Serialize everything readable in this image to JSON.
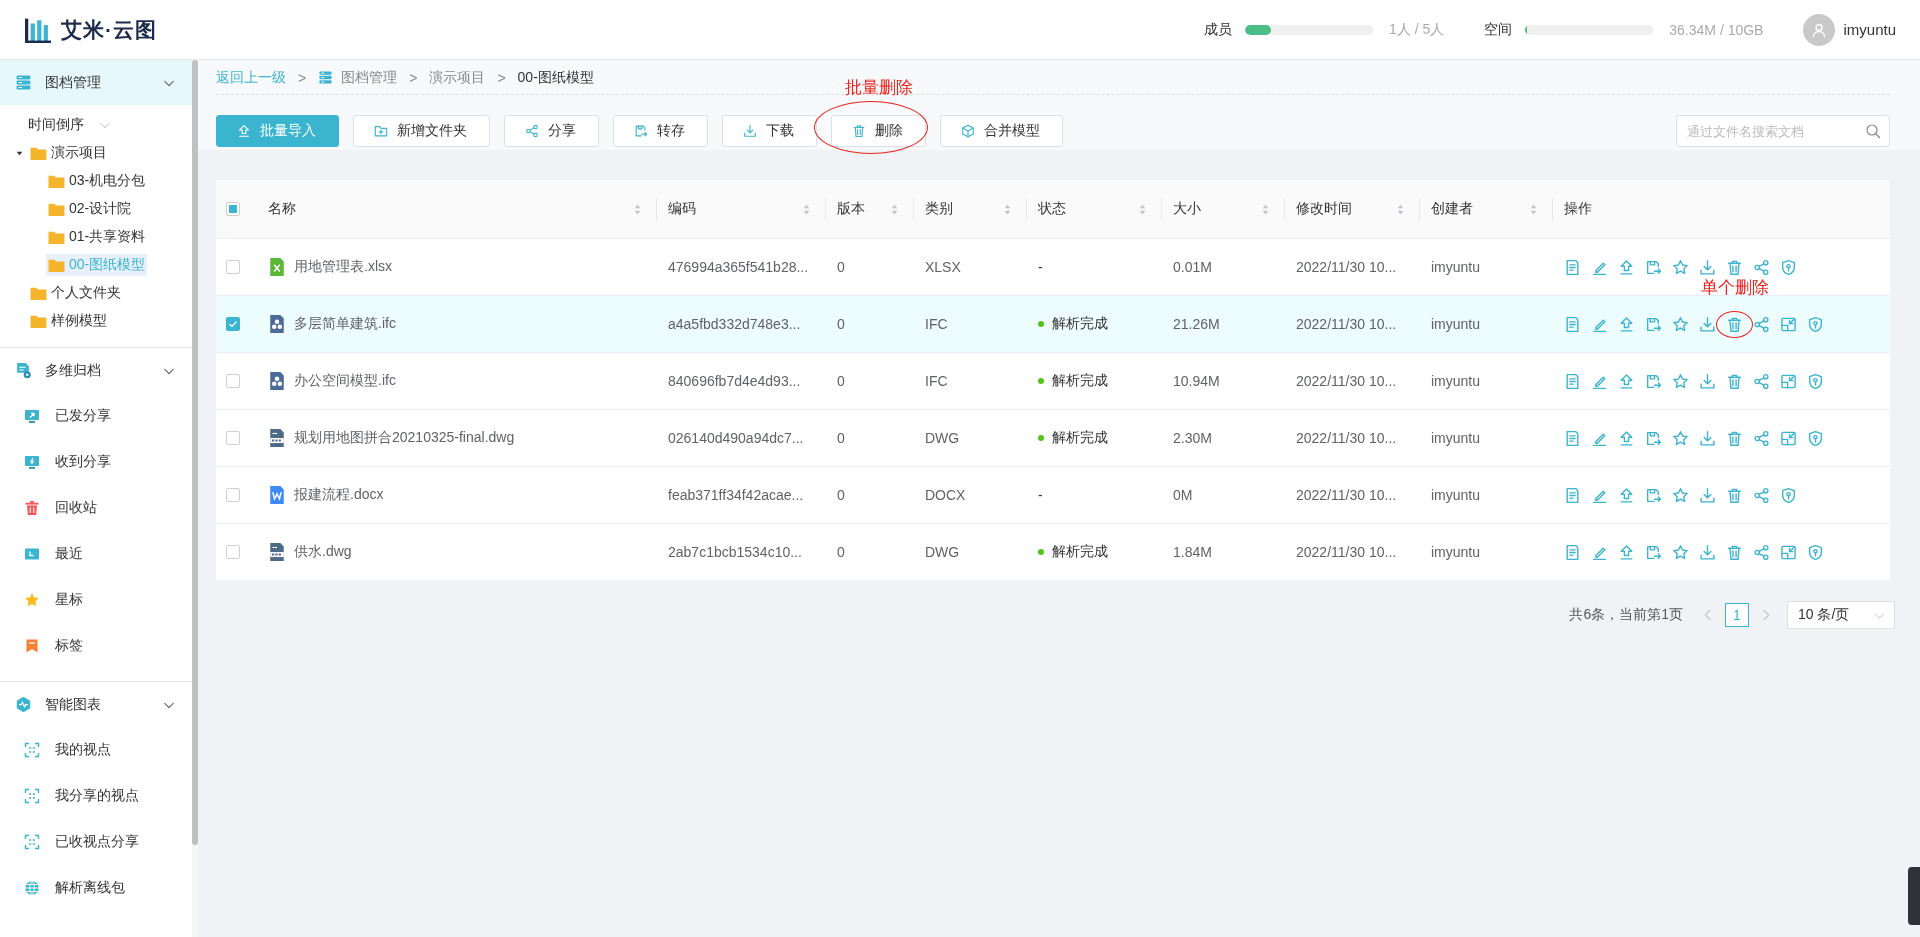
{
  "header": {
    "logo": "艾米·云图",
    "meters": [
      {
        "label": "成员",
        "level": 0.2,
        "reading": "1人 / 5人"
      },
      {
        "label": "空间",
        "level": 0.004,
        "reading": "36.34M / 10GB"
      }
    ],
    "user": "imyuntu"
  },
  "sidebar": {
    "sections": [
      {
        "title": "图档管理",
        "kind": "files",
        "active": true,
        "expanded": true,
        "sort": "时间倒序",
        "tree": [
          {
            "label": "演示项目",
            "selected": false,
            "expanded": true,
            "children": [
              {
                "label": "03-机电分包",
                "selected": false
              },
              {
                "label": "02-设计院",
                "selected": false
              },
              {
                "label": "01-共享资料",
                "selected": false
              },
              {
                "label": "00-图纸模型",
                "selected": true
              }
            ]
          },
          {
            "label": "个人文件夹",
            "selected": false
          },
          {
            "label": "样例模型",
            "selected": false
          }
        ]
      },
      {
        "title": "多维归档",
        "kind": "archive",
        "active": false,
        "expanded": true,
        "items": [
          {
            "label": "已发分享",
            "kind": "sent"
          },
          {
            "label": "收到分享",
            "kind": "received"
          },
          {
            "label": "回收站",
            "kind": "trash"
          },
          {
            "label": "最近",
            "kind": "recent"
          },
          {
            "label": "星标",
            "kind": "star"
          },
          {
            "label": "标签",
            "kind": "tag"
          }
        ]
      },
      {
        "title": "智能图表",
        "kind": "chart",
        "active": false,
        "expanded": true,
        "items": [
          {
            "label": "我的视点",
            "kind": "viewpoint"
          },
          {
            "label": "我分享的视点",
            "kind": "viewpoint"
          },
          {
            "label": "已收视点分享",
            "kind": "viewpoint"
          },
          {
            "label": "解析离线包",
            "kind": "package"
          }
        ]
      }
    ]
  },
  "breadcrumb": {
    "back": "返回上一级",
    "items": [
      {
        "sep": ">",
        "label": "图档管理",
        "kind": "root",
        "current": false
      },
      {
        "sep": ">",
        "label": "演示项目",
        "kind": "folder",
        "current": false
      },
      {
        "sep": ">",
        "label": "00-图纸模型",
        "kind": "folder",
        "current": true
      }
    ]
  },
  "toolbar": {
    "buttons": [
      {
        "label": "批量导入",
        "kind": "primary"
      },
      {
        "label": "新增文件夹",
        "kind": "default"
      },
      {
        "label": "分享",
        "kind": "default"
      },
      {
        "label": "转存",
        "kind": "default"
      },
      {
        "label": "下载",
        "kind": "default"
      },
      {
        "label": "删除",
        "kind": "default",
        "annotation": "批量删除"
      },
      {
        "label": "合并模型",
        "kind": "default"
      }
    ],
    "search": {
      "placeholder": "通过文件名搜索文档"
    }
  },
  "table": {
    "select_all": {
      "indeterminate": true
    },
    "columns": [
      {
        "label": "名称",
        "sortable": true
      },
      {
        "label": "编码",
        "sortable": true
      },
      {
        "label": "版本",
        "sortable": true
      },
      {
        "label": "类别",
        "sortable": true
      },
      {
        "label": "状态",
        "sortable": true
      },
      {
        "label": "大小",
        "sortable": true
      },
      {
        "label": "修改时间",
        "sortable": true
      },
      {
        "label": "创建者",
        "sortable": true
      },
      {
        "label": "操作",
        "sortable": false
      }
    ],
    "rows": [
      {
        "selected": false,
        "kind": "excel",
        "name": "用地管理表.xlsx",
        "code": "476994a365f541b28...",
        "version": "0",
        "type": "XLSX",
        "status": "-",
        "parsed": false,
        "size": "0.01M",
        "modified": "2022/11/30 10...",
        "creator": "imyuntu",
        "actions": [
          {
            "kind": "info"
          },
          {
            "kind": "edit"
          },
          {
            "kind": "upload"
          },
          {
            "kind": "saveas"
          },
          {
            "kind": "star"
          },
          {
            "kind": "download"
          },
          {
            "kind": "delete"
          },
          {
            "kind": "share"
          },
          {
            "kind": "shield"
          }
        ]
      },
      {
        "selected": true,
        "kind": "ifc",
        "name": "多层简单建筑.ifc",
        "code": "a4a5fbd332d748e3...",
        "version": "0",
        "type": "IFC",
        "status": "解析完成",
        "parsed": true,
        "size": "21.26M",
        "modified": "2022/11/30 10...",
        "creator": "imyuntu",
        "actions": [
          {
            "kind": "info"
          },
          {
            "kind": "edit"
          },
          {
            "kind": "upload"
          },
          {
            "kind": "saveas"
          },
          {
            "kind": "star"
          },
          {
            "kind": "download"
          },
          {
            "kind": "delete",
            "annotation": "单个删除"
          },
          {
            "kind": "share"
          },
          {
            "kind": "model"
          },
          {
            "kind": "shield"
          }
        ]
      },
      {
        "selected": false,
        "kind": "ifc",
        "name": "办公空间模型.ifc",
        "code": "840696fb7d4e4d93...",
        "version": "0",
        "type": "IFC",
        "status": "解析完成",
        "parsed": true,
        "size": "10.94M",
        "modified": "2022/11/30 10...",
        "creator": "imyuntu",
        "actions": [
          {
            "kind": "info"
          },
          {
            "kind": "edit"
          },
          {
            "kind": "upload"
          },
          {
            "kind": "saveas"
          },
          {
            "kind": "star"
          },
          {
            "kind": "download"
          },
          {
            "kind": "delete"
          },
          {
            "kind": "share"
          },
          {
            "kind": "model"
          },
          {
            "kind": "shield"
          }
        ]
      },
      {
        "selected": false,
        "kind": "cad",
        "name": "规划用地图拼合20210325-final.dwg",
        "code": "026140d490a94dc7...",
        "version": "0",
        "type": "DWG",
        "status": "解析完成",
        "parsed": true,
        "size": "2.30M",
        "modified": "2022/11/30 10...",
        "creator": "imyuntu",
        "actions": [
          {
            "kind": "info"
          },
          {
            "kind": "edit"
          },
          {
            "kind": "upload"
          },
          {
            "kind": "saveas"
          },
          {
            "kind": "star"
          },
          {
            "kind": "download"
          },
          {
            "kind": "delete"
          },
          {
            "kind": "share"
          },
          {
            "kind": "model"
          },
          {
            "kind": "shield"
          }
        ]
      },
      {
        "selected": false,
        "kind": "word",
        "name": "报建流程.docx",
        "code": "feab371ff34f42acae...",
        "version": "0",
        "type": "DOCX",
        "status": "-",
        "parsed": false,
        "size": "0M",
        "modified": "2022/11/30 10...",
        "creator": "imyuntu",
        "actions": [
          {
            "kind": "info"
          },
          {
            "kind": "edit"
          },
          {
            "kind": "upload"
          },
          {
            "kind": "saveas"
          },
          {
            "kind": "star"
          },
          {
            "kind": "download"
          },
          {
            "kind": "delete"
          },
          {
            "kind": "share"
          },
          {
            "kind": "shield"
          }
        ]
      },
      {
        "selected": false,
        "kind": "cad",
        "name": "供水.dwg",
        "code": "2ab7c1bcb1534c10...",
        "version": "0",
        "type": "DWG",
        "status": "解析完成",
        "parsed": true,
        "size": "1.84M",
        "modified": "2022/11/30 10...",
        "creator": "imyuntu",
        "actions": [
          {
            "kind": "info"
          },
          {
            "kind": "edit"
          },
          {
            "kind": "upload"
          },
          {
            "kind": "saveas"
          },
          {
            "kind": "star"
          },
          {
            "kind": "download"
          },
          {
            "kind": "delete"
          },
          {
            "kind": "share"
          },
          {
            "kind": "model"
          },
          {
            "kind": "shield"
          }
        ]
      }
    ]
  },
  "pagination": {
    "summary": "共6条，当前第1页",
    "pages": [
      {
        "label": "1",
        "selected": true
      }
    ],
    "page_size": "10 条/页"
  }
}
